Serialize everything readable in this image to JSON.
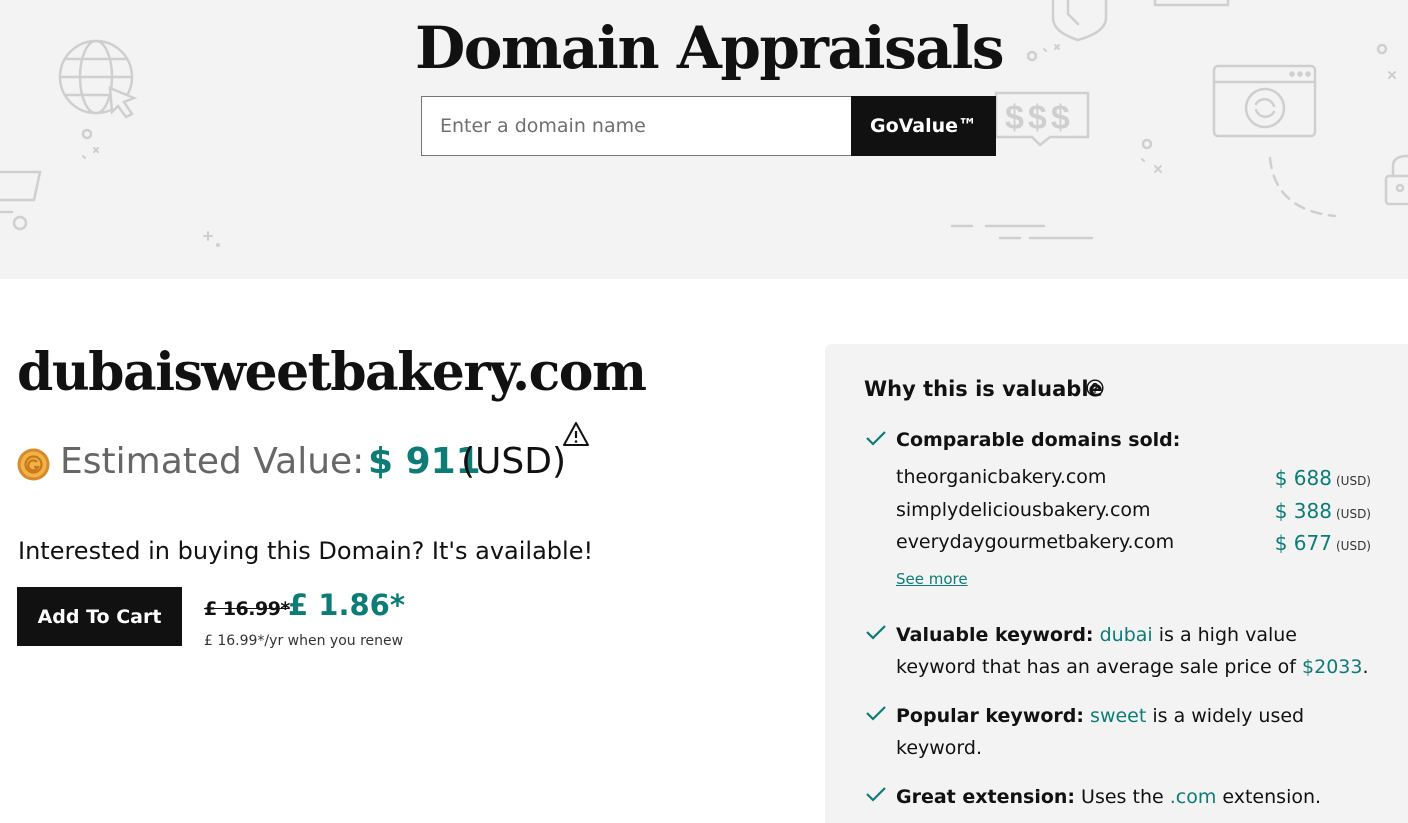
{
  "hero": {
    "title": "Domain Appraisals",
    "search_placeholder": "Enter a domain name",
    "search_value": "",
    "govalue_label": "GoValue™",
    "deco_money_text": "$$$"
  },
  "result": {
    "domain": "dubaisweetbakery.com",
    "estimated_label": "Estimated Value:",
    "estimated_value": "$ 911",
    "estimated_unit": "(USD)",
    "interested_text": "Interested in buying this Domain? It's available!",
    "add_to_cart_label": "Add To Cart",
    "old_price": "£ 16.99*",
    "new_price": "£ 1.86*",
    "renew_note": "£ 16.99*/yr when you renew"
  },
  "panel": {
    "title": "Why this is valuable",
    "comparable": {
      "heading": "Comparable domains sold:",
      "items": [
        {
          "domain": "theorganicbakery.com",
          "price": "$ 688",
          "unit": "(USD)"
        },
        {
          "domain": "simplydeliciousbakery.com",
          "price": "$ 388",
          "unit": "(USD)"
        },
        {
          "domain": "everydaygourmetbakery.com",
          "price": "$ 677",
          "unit": "(USD)"
        }
      ],
      "see_more": "See more"
    },
    "valuable_keyword": {
      "heading": "Valuable keyword:",
      "keyword": "dubai",
      "text_mid": " is a high value keyword that has an average sale price of ",
      "price": "$2033",
      "text_end": "."
    },
    "popular_keyword": {
      "heading": "Popular keyword:",
      "keyword": "sweet",
      "text_end": " is a widely used keyword."
    },
    "great_extension": {
      "heading": "Great extension:",
      "text_start": " Uses the ",
      "extension": ".com",
      "text_end": " extension."
    }
  },
  "colors": {
    "accent_teal": "#0e7c76",
    "hero_bg": "#f3f3f3",
    "panel_bg": "#f3f3f3",
    "button_bg": "#111111",
    "coin_gold": "#e8a23a"
  },
  "icons": {
    "coin": "godaddy-coin-icon",
    "warning": "warning-triangle-icon",
    "help": "question-circle-icon",
    "check": "check-icon"
  }
}
